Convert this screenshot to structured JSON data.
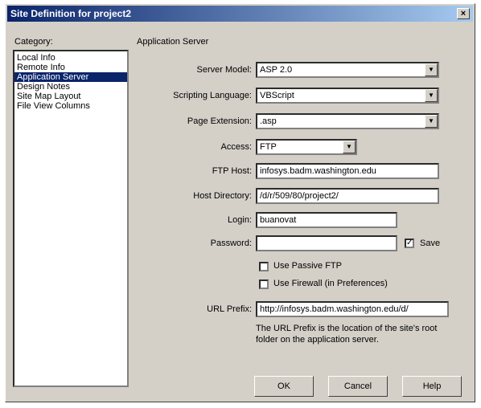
{
  "window": {
    "title": "Site Definition for project2",
    "close": "×"
  },
  "category": {
    "label": "Category:",
    "items": [
      "Local Info",
      "Remote Info",
      "Application Server",
      "Design Notes",
      "Site Map Layout",
      "File View Columns"
    ],
    "selected": "Application Server"
  },
  "section_title": "Application Server",
  "form": {
    "server_model": {
      "label": "Server Model:",
      "value": "ASP 2.0"
    },
    "scripting_language": {
      "label": "Scripting Language:",
      "value": "VBScript"
    },
    "page_extension": {
      "label": "Page Extension:",
      "value": ".asp"
    },
    "access": {
      "label": "Access:",
      "value": "FTP"
    },
    "ftp_host": {
      "label": "FTP Host:",
      "value": "infosys.badm.washington.edu"
    },
    "host_directory": {
      "label": "Host Directory:",
      "value": "/d/r/509/80/project2/"
    },
    "login": {
      "label": "Login:",
      "value": "buanovat"
    },
    "password": {
      "label": "Password:",
      "value": "",
      "save_label": "Save",
      "save_checked": true
    },
    "passive_ftp": {
      "label": "Use Passive FTP",
      "checked": false
    },
    "firewall": {
      "label": "Use Firewall (in Preferences)",
      "checked": false
    },
    "url_prefix": {
      "label": "URL Prefix:",
      "value": "http://infosys.badm.washington.edu/d/"
    },
    "note": "The URL Prefix is the location of the site's root folder on the application server."
  },
  "buttons": {
    "ok": "OK",
    "cancel": "Cancel",
    "help": "Help"
  }
}
